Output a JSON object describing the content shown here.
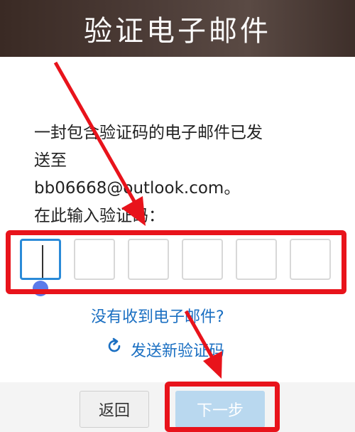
{
  "header": {
    "title": "验证电子邮件"
  },
  "message": {
    "line1": "一封包含验证码的电子邮件已发",
    "line2": "送至",
    "email": "bb06668@outlook.com。",
    "prompt": "在此输入验证码："
  },
  "code_inputs": [
    "",
    "",
    "",
    "",
    "",
    ""
  ],
  "links": {
    "no_email": "没有收到电子邮件?",
    "resend": "发送新验证码"
  },
  "buttons": {
    "back": "返回",
    "next": "下一步"
  },
  "colors": {
    "accent": "#1a6fc2",
    "annotation": "#e8131b",
    "header_bg": "#4b3b36"
  }
}
